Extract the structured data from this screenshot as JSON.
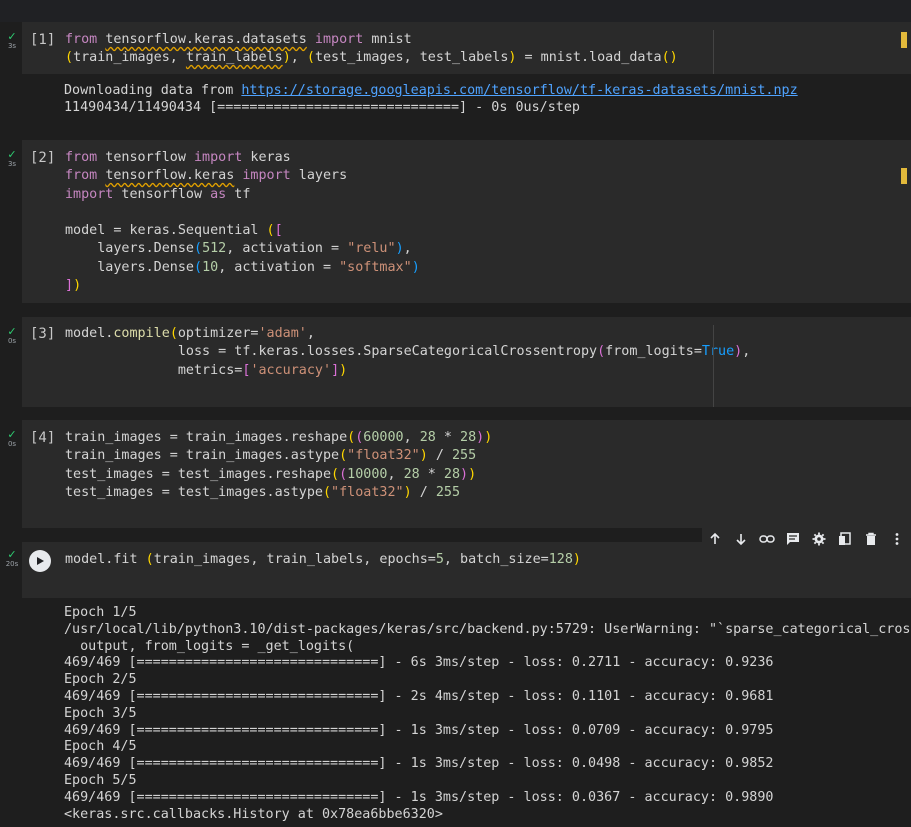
{
  "cells": [
    {
      "prompt": "[1]",
      "status_time": "3s",
      "code_lines": [
        "from tensorflow.keras.datasets import mnist",
        "(train_images, train_labels), (test_images, test_labels) = mnist.load_data()"
      ],
      "output_lines": [
        {
          "prefix": "Downloading data from ",
          "link": "https://storage.googleapis.com/tensorflow/tf-keras-datasets/mnist.npz"
        },
        {
          "text": "11490434/11490434 [==============================] - 0s 0us/step"
        }
      ]
    },
    {
      "prompt": "[2]",
      "status_time": "3s",
      "code_lines": [
        "from tensorflow import keras",
        "from tensorflow.keras import layers",
        "import tensorflow as tf",
        "",
        "model = keras.Sequential ([",
        "    layers.Dense(512, activation = \"relu\"),",
        "    layers.Dense(10, activation = \"softmax\")",
        "])"
      ]
    },
    {
      "prompt": "[3]",
      "status_time": "0s",
      "code_lines": [
        "model.compile(optimizer='adam',",
        "              loss = tf.keras.losses.SparseCategoricalCrossentropy(from_logits=True),",
        "              metrics=['accuracy'])"
      ]
    },
    {
      "prompt": "[4]",
      "status_time": "0s",
      "code_lines": [
        "train_images = train_images.reshape((60000, 28 * 28))",
        "train_images = train_images.astype(\"float32\") / 255",
        "test_images = test_images.reshape((10000, 28 * 28))",
        "test_images = test_images.astype(\"float32\") / 255"
      ]
    },
    {
      "prompt": "",
      "status_time": "20s",
      "code_lines": [
        "model.fit (train_images, train_labels, epochs=5, batch_size=128)"
      ],
      "output_lines": [
        "Epoch 1/5",
        "/usr/local/lib/python3.10/dist-packages/keras/src/backend.py:5729: UserWarning: \"`sparse_categorical_cros",
        "  output, from_logits = _get_logits(",
        "469/469 [==============================] - 6s 3ms/step - loss: 0.2711 - accuracy: 0.9236",
        "Epoch 2/5",
        "469/469 [==============================] - 2s 4ms/step - loss: 0.1101 - accuracy: 0.9681",
        "Epoch 3/5",
        "469/469 [==============================] - 1s 3ms/step - loss: 0.0709 - accuracy: 0.9795",
        "Epoch 4/5",
        "469/469 [==============================] - 1s 3ms/step - loss: 0.0498 - accuracy: 0.9852",
        "Epoch 5/5",
        "469/469 [==============================] - 1s 3ms/step - loss: 0.0367 - accuracy: 0.9890",
        "<keras.src.callbacks.History at 0x78ea6bbe6320>"
      ]
    }
  ],
  "toolbar": {
    "icons": [
      "move-up-icon",
      "move-down-icon",
      "link-icon",
      "comment-icon",
      "settings-icon",
      "mirror-cell-icon",
      "delete-icon",
      "more-options-icon"
    ]
  },
  "colors": {
    "keyword": "#c586c0",
    "string": "#ce9178",
    "number": "#b5cea8",
    "function": "#dcdcaa",
    "success": "#2ecc71",
    "cell_bg": "#2a2a2a",
    "page_bg": "#1e1e1e"
  }
}
